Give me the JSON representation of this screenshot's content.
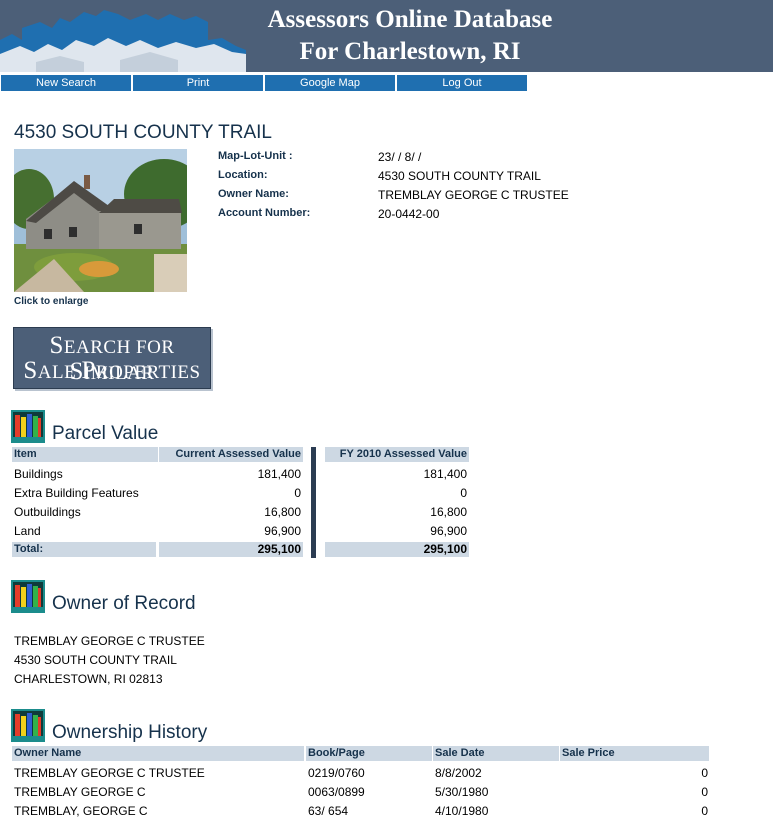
{
  "banner": {
    "title_line1": "Assessors Online Database",
    "title_line2": "For Charlestown, RI"
  },
  "nav": [
    "New Search",
    "Print",
    "Google Map",
    "Log Out"
  ],
  "property": {
    "address_title": "4530 SOUTH COUNTY TRAIL",
    "photo_caption": "Click to enlarge",
    "fields": [
      {
        "label": "Map-Lot-Unit :",
        "value": "23/ / 8/ /"
      },
      {
        "label": "Location:",
        "value": "4530 SOUTH COUNTY TRAIL"
      },
      {
        "label": "Owner Name:",
        "value": "TREMBLAY GEORGE C TRUSTEE"
      },
      {
        "label": "Account Number:",
        "value": "20-0442-00"
      }
    ]
  },
  "similar_button": {
    "line1_big": "S",
    "line1_rest": "EARCH FOR ",
    "line1_big2": "S",
    "line1_rest2": "IMILAR",
    "line2_big": "S",
    "line2_rest": "ALE ",
    "line2_big2": "P",
    "line2_rest2": "ROPERTIES"
  },
  "parcel_value": {
    "title": "Parcel Value",
    "headers": [
      "Item",
      "Current Assessed Value",
      "FY 2010 Assessed Value"
    ],
    "rows": [
      {
        "item": "Buildings",
        "current": "181,400",
        "fy2010": "181,400"
      },
      {
        "item": "Extra Building Features",
        "current": "0",
        "fy2010": "0"
      },
      {
        "item": "Outbuildings",
        "current": "16,800",
        "fy2010": "16,800"
      },
      {
        "item": "Land",
        "current": "96,900",
        "fy2010": "96,900"
      }
    ],
    "total": {
      "item": "Total:",
      "current": "295,100",
      "fy2010": "295,100"
    }
  },
  "owner_of_record": {
    "title": "Owner of Record",
    "lines": [
      "TREMBLAY GEORGE C TRUSTEE",
      "4530 SOUTH COUNTY TRAIL",
      "CHARLESTOWN, RI 02813"
    ]
  },
  "ownership_history": {
    "title": "Ownership History",
    "headers": [
      "Owner Name",
      "Book/Page",
      "Sale Date",
      "Sale Price"
    ],
    "rows": [
      {
        "owner": "TREMBLAY GEORGE C TRUSTEE",
        "book": "0219/0760",
        "date": "8/8/2002",
        "price": "0"
      },
      {
        "owner": "TREMBLAY GEORGE C",
        "book": "0063/0899",
        "date": "5/30/1980",
        "price": "0"
      },
      {
        "owner": "TREMBLAY, GEORGE C",
        "book": "63/ 654",
        "date": "4/10/1980",
        "price": "0"
      }
    ]
  }
}
